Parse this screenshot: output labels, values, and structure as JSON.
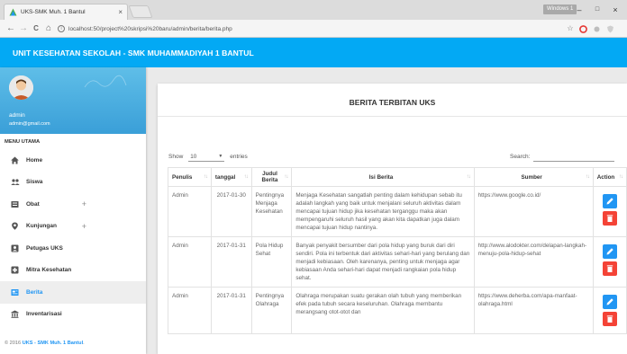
{
  "browser": {
    "tab_title": "UKS-SMK Muh. 1 Bantul",
    "tab_close": "×",
    "url": "localhost:50/project%20skripsi%20baru/admin/berita/berita.php",
    "window_user": "Windows 1",
    "nav": {
      "back": "←",
      "forward": "→",
      "reload": "C",
      "home": "⌂",
      "info": "i"
    },
    "window_controls": {
      "minimize": "–",
      "maximize": "□",
      "close": "×"
    },
    "toolbar": {
      "star": "☆"
    }
  },
  "header": {
    "title": "UNIT KESEHATAN SEKOLAH - SMK MUHAMMADIYAH 1 BANTUL"
  },
  "sidebar": {
    "user_name": "admin",
    "user_email": "admin@gmail.com",
    "menu_header": "MENU UTAMA",
    "items": [
      {
        "label": "Home",
        "icon": "home-icon",
        "expandable": false,
        "active": false
      },
      {
        "label": "Siswa",
        "icon": "users-icon",
        "expandable": false,
        "active": false
      },
      {
        "label": "Obat",
        "icon": "pills-icon",
        "expandable": true,
        "active": false
      },
      {
        "label": "Kunjungan",
        "icon": "location-icon",
        "expandable": true,
        "active": false
      },
      {
        "label": "Petugas UKS",
        "icon": "staff-icon",
        "expandable": false,
        "active": false
      },
      {
        "label": "Mitra Kesehatan",
        "icon": "partner-icon",
        "expandable": false,
        "active": false
      },
      {
        "label": "Berita",
        "icon": "news-icon",
        "expandable": false,
        "active": true
      },
      {
        "label": "Inventarisasi",
        "icon": "inventory-icon",
        "expandable": false,
        "active": false
      }
    ],
    "expand_symbol": "+",
    "footer_prefix": "© 2016 ",
    "footer_link": "UKS - SMK Muh. 1 Bantul",
    "footer_suffix": "."
  },
  "card": {
    "title": "BERITA TERBITAN UKS",
    "show_label": "Show",
    "entries_value": "10",
    "entries_label": "entries",
    "search_label": "Search:",
    "search_value": ""
  },
  "table": {
    "columns": [
      "Penulis",
      "tanggal",
      "Judul Berita",
      "Isi Berita",
      "Sumber",
      "Action"
    ],
    "rows": [
      {
        "penulis": "Admin",
        "tanggal": "2017-01-30",
        "judul": "Pentingnya Menjaga Kesehatan",
        "isi": "Menjaga Kesehatan sangatlah penting dalam kehidupan sebab itu adalah langkah yang baik untuk menjalani seluruh aktivitas dalam mencapai tujuan hidup jika kesehatan terganggu maka akan mempengaruhi seluruh hasil yang akan kita dapatkan juga dalam mencapai tujuan hidup nantinya.",
        "sumber": "https://www.google.co.id/"
      },
      {
        "penulis": "Admin",
        "tanggal": "2017-01-31",
        "judul": "Pola Hidup Sehat",
        "isi": "Banyak penyakit bersumber dari pola hidup yang buruk dari diri sendiri. Pola ini terbentuk dari aktivitas sehari-hari yang berulang dan menjadi kebiasaan. Oleh karenanya, penting untuk menjaga agar kebiasaan Anda sehari-hari dapat menjadi rangkaian pola hidup sehat.",
        "sumber": "http://www.alodokter.com/delapan-langkah-menuju-pola-hidup-sehat"
      },
      {
        "penulis": "Admin",
        "tanggal": "2017-01-31",
        "judul": "Pentingnya Olahraga",
        "isi": "Olahraga merupakan suatu gerakan olah tubuh yang memberikan efek pada tubuh secara keseluruhan. Olahraga membantu merangsang otot-otot dan",
        "sumber": "https://www.deherba.com/apa-manfaat-olahraga.html"
      }
    ]
  },
  "colors": {
    "header_bg": "#03a9f4",
    "edit_button": "#2196f3",
    "delete_button": "#f44336",
    "active_menu_text": "#2196f3"
  }
}
